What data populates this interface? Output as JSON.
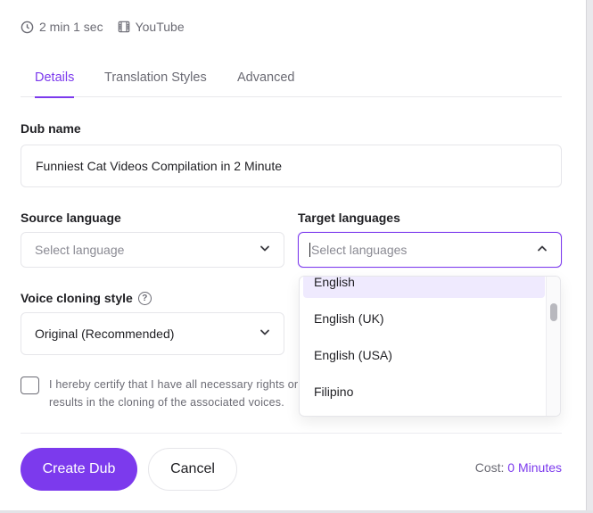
{
  "meta": {
    "duration": "2 min 1 sec",
    "duration_icon": "clock-icon",
    "source": "YouTube",
    "source_icon": "film-icon"
  },
  "tabs": [
    {
      "label": "Details",
      "active": true
    },
    {
      "label": "Translation Styles",
      "active": false
    },
    {
      "label": "Advanced",
      "active": false
    }
  ],
  "dub_name": {
    "label": "Dub name",
    "value": "Funniest Cat Videos Compilation in 2 Minute"
  },
  "source_language": {
    "label": "Source language",
    "placeholder": "Select language"
  },
  "target_languages": {
    "label": "Target languages",
    "placeholder": "Select languages",
    "options": [
      "English",
      "English (UK)",
      "English (USA)",
      "Filipino"
    ],
    "highlighted": "English"
  },
  "voice_cloning": {
    "label": "Voice cloning style",
    "help_icon": "help-circle-icon",
    "value": "Original (Recommended)"
  },
  "certify": {
    "line1": "I hereby certify that I have all necessary rights or co",
    "line2": "results in the cloning of the associated voices."
  },
  "actions": {
    "create_label": "Create Dub",
    "cancel_label": "Cancel"
  },
  "cost": {
    "label": "Cost: ",
    "value": "0 Minutes"
  },
  "colors": {
    "accent": "#7c3aed",
    "highlight": "#efeafe",
    "muted_text": "#6b6b74"
  }
}
